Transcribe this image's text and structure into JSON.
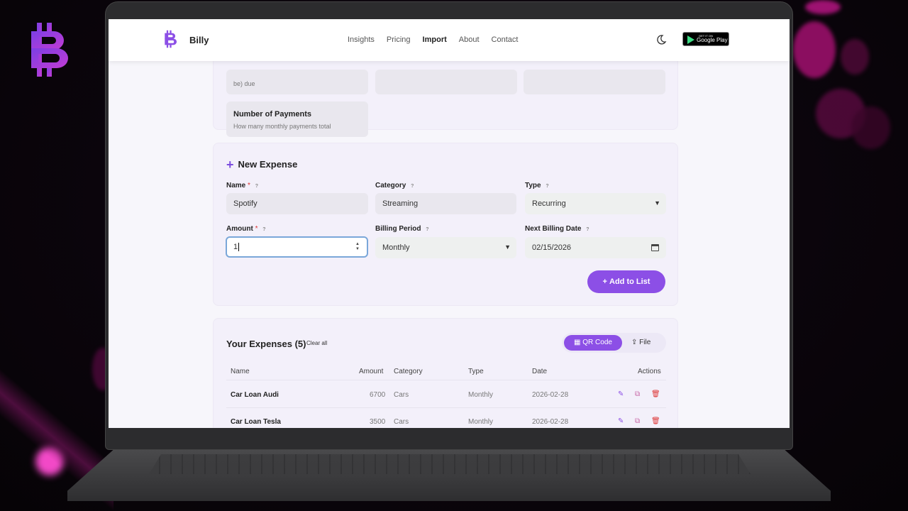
{
  "colors": {
    "accent": "#8c4fe6",
    "accent_light": "#f3f0fa",
    "danger": "#dd3333"
  },
  "navbar": {
    "title": "Billy",
    "links": [
      "Insights",
      "Pricing",
      "Import",
      "About",
      "Contact"
    ],
    "active_link": "Import",
    "theme_icon": "moon-icon",
    "store_badge": {
      "small": "GET IT ON",
      "large": "Google Play"
    }
  },
  "top_card": {
    "fields": [
      {
        "title": "",
        "desc": "be) due"
      },
      {
        "title": "",
        "desc": ""
      },
      {
        "title": "",
        "desc": ""
      },
      {
        "title": "Number of Payments",
        "desc": "How many monthly payments total"
      }
    ]
  },
  "new_expense": {
    "title": "New Expense",
    "name_label": "Name",
    "name_value": "Spotify",
    "category_label": "Category",
    "category_value": "Streaming",
    "type_label": "Type",
    "type_value": "Recurring",
    "amount_label": "Amount",
    "amount_value": "1",
    "billing_period_label": "Billing Period",
    "billing_period_value": "Monthly",
    "next_billing_label": "Next Billing Date",
    "next_billing_value": "02/15/2026",
    "required_mark": "*",
    "help_mark": "?",
    "add_button": "Add to List"
  },
  "expenses": {
    "title": "Your Expenses (5)",
    "clear_all": "Clear all",
    "toggle_qr": "QR Code",
    "toggle_file": "File",
    "headers": [
      "Name",
      "Amount",
      "Category",
      "Type",
      "Date",
      "Actions"
    ],
    "rows": [
      {
        "name": "Car Loan Audi",
        "amount": "6700",
        "category": "Cars",
        "type": "Monthly",
        "date": "2026-02-28"
      },
      {
        "name": "Car Loan Tesla",
        "amount": "3500",
        "category": "Cars",
        "type": "Monthly",
        "date": "2026-02-28"
      }
    ]
  }
}
